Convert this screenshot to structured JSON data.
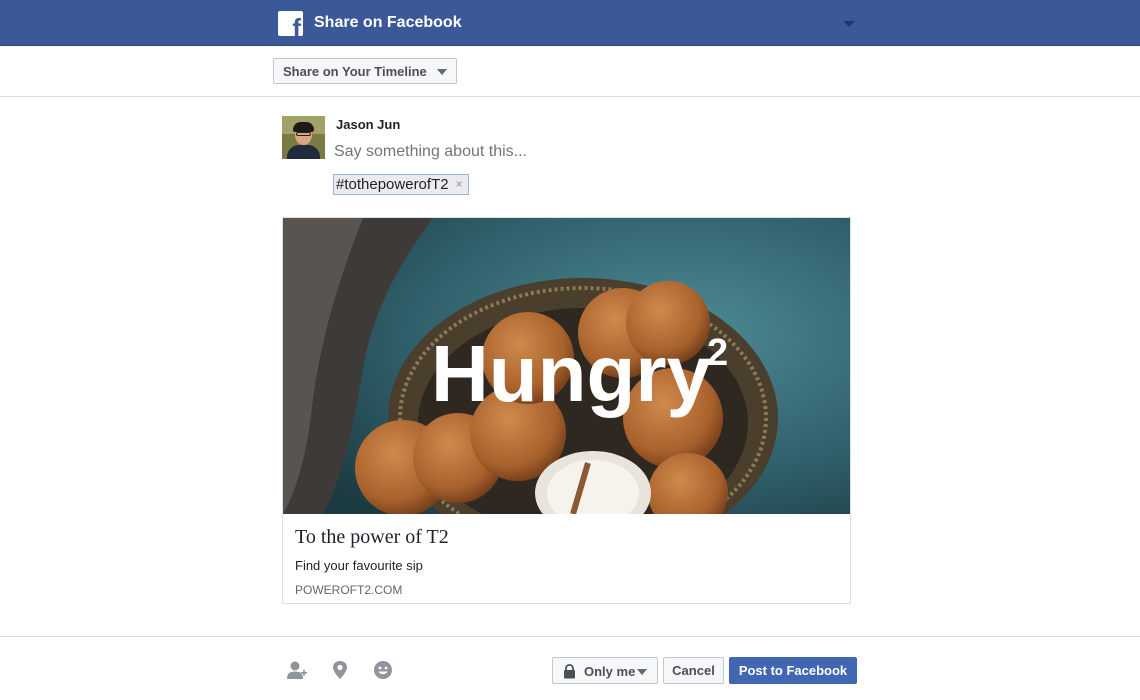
{
  "header": {
    "logo_letter": "f",
    "title": "Share on Facebook"
  },
  "audience": {
    "selector_label": "Share on Your Timeline"
  },
  "composer": {
    "user_name": "Jason Jun",
    "placeholder": "Say something about this...",
    "hashtag": "#tothepowerofT2",
    "hashtag_remove": "×"
  },
  "link_preview": {
    "image_headline": "Hungry",
    "image_superscript": "2",
    "title": "To the power of T2",
    "description": "Find your favourite sip",
    "domain": "POWEROFT2.COM"
  },
  "footer": {
    "icons": [
      "tag-friends-icon",
      "location-icon",
      "feeling-icon"
    ],
    "privacy_label": "Only me",
    "cancel_label": "Cancel",
    "post_label": "Post to Facebook"
  },
  "colors": {
    "brand": "#3b5998",
    "primary_button": "#4267b2"
  }
}
